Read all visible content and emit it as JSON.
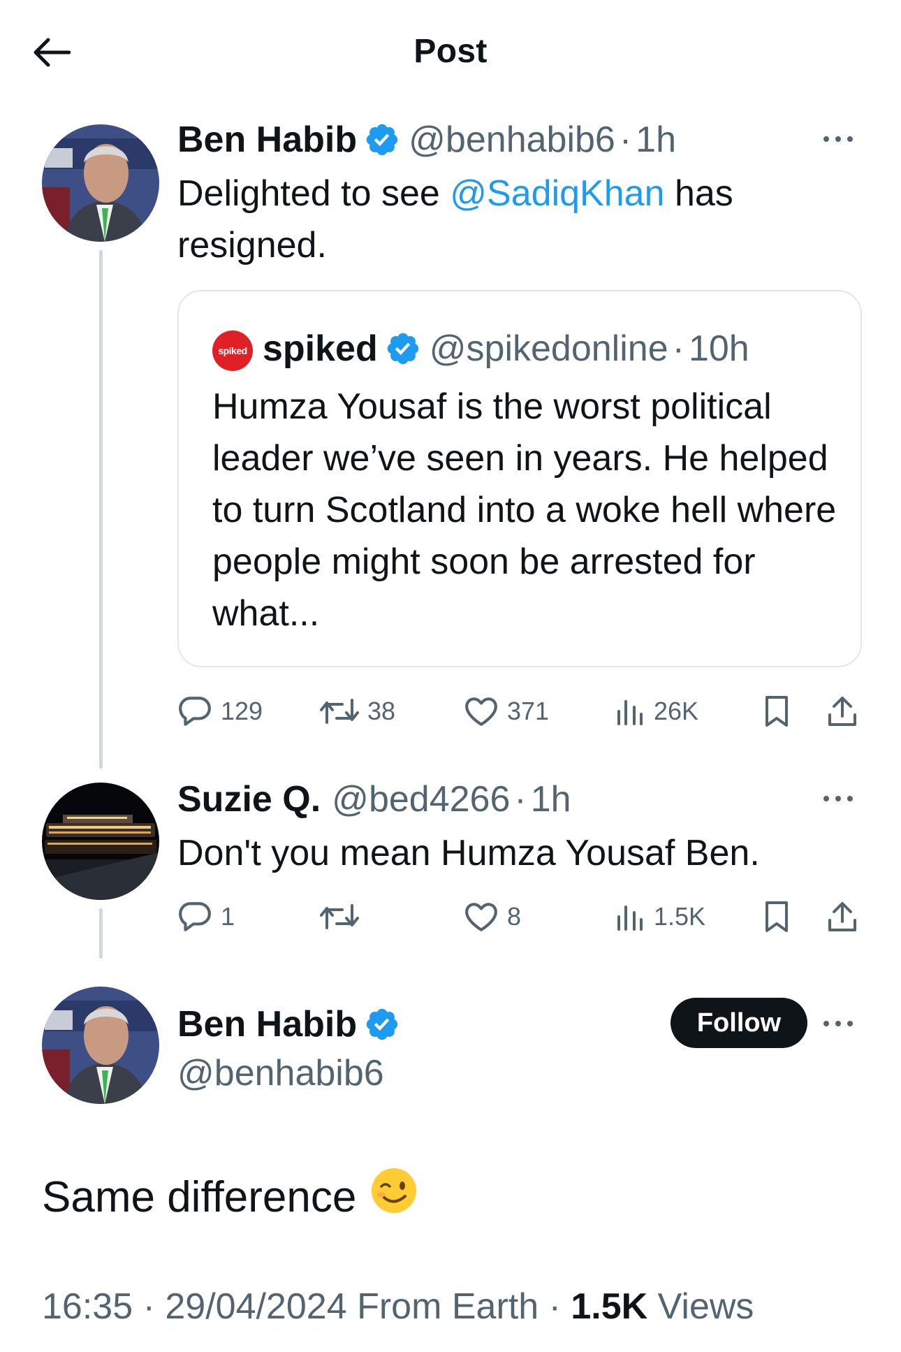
{
  "header": {
    "title": "Post"
  },
  "post1": {
    "name": "Ben Habib",
    "handle": "@benhabib6",
    "dot": "·",
    "time": "1h",
    "text_before": "Delighted to see ",
    "mention": "@SadiqKhan",
    "text_after": " has resigned.",
    "quote": {
      "logo_text": "spiked",
      "name": "spiked",
      "handle": "@spikedonline",
      "time": "10h",
      "text": "Humza Yousaf is the worst political leader we’ve seen in years. He helped to turn Scotland into a woke hell where people might soon be arrested for what..."
    },
    "stats": {
      "replies": "129",
      "reposts": "38",
      "likes": "371",
      "views": "26K"
    }
  },
  "post2": {
    "name": "Suzie Q.",
    "handle": "@bed4266",
    "time": "1h",
    "text": "Don't you mean Humza Yousaf Ben.",
    "stats": {
      "replies": "1",
      "reposts": "",
      "likes": "8",
      "views": "1.5K"
    }
  },
  "post3": {
    "name": "Ben Habib",
    "handle": "@benhabib6",
    "follow_label": "Follow",
    "text": "Same difference",
    "emoji": "winking-face",
    "meta_time": "16:35",
    "meta_date": "29/04/2024",
    "meta_source": "From Earth",
    "meta_views_count": "1.5K",
    "meta_views_label": "Views"
  },
  "colors": {
    "accent": "#1d9bf0",
    "muted": "#536471",
    "text": "#0f1419",
    "verified": "#1d9bf0"
  }
}
